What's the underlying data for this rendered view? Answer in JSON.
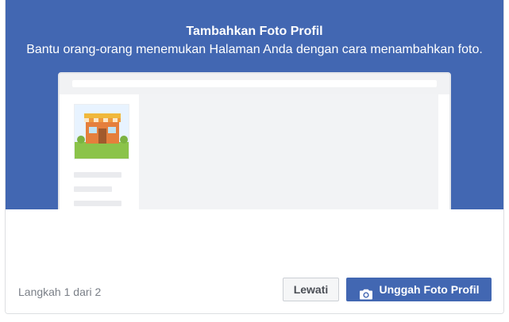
{
  "dialog": {
    "title": "Tambahkan Foto Profil",
    "subtitle": "Bantu orang-orang menemukan Halaman Anda dengan cara menambahkan foto."
  },
  "preview": {
    "profile_icon": "storefront-icon",
    "action_icon": "camera-icon"
  },
  "footer": {
    "step_text": "Langkah 1 dari 2",
    "skip_label": "Lewati",
    "upload_label": "Unggah Foto Profil"
  },
  "colors": {
    "brand_blue": "#4267b2",
    "skip_bg": "#f5f6f7",
    "placeholder_gray": "#eaebee"
  }
}
